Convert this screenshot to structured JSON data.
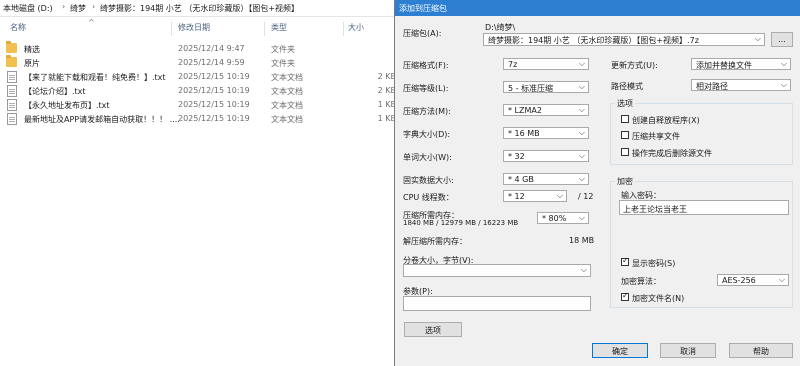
{
  "explorer": {
    "breadcrumb": [
      "本地磁盘 (D:)",
      "绮梦",
      "绮梦摄影：194期 小艺 （无水印珍藏版）【图包+视频】"
    ],
    "columns": {
      "name": "名称",
      "date": "修改日期",
      "type": "类型",
      "size": "大小"
    },
    "rows": [
      {
        "kind": "folder",
        "name": "精选",
        "date": "2025/12/14 9:47",
        "type": "文件夹",
        "size": ""
      },
      {
        "kind": "folder",
        "name": "原片",
        "date": "2025/12/14 9:59",
        "type": "文件夹",
        "size": ""
      },
      {
        "kind": "file",
        "name": "【来了就能下载和观看！纯免费！】.txt",
        "date": "2025/12/15 10:19",
        "type": "文本文档",
        "size": "2 KB"
      },
      {
        "kind": "file",
        "name": "【论坛介绍】.txt",
        "date": "2025/12/15 10:19",
        "type": "文本文档",
        "size": "2 KB"
      },
      {
        "kind": "file",
        "name": "【永久地址发布页】.txt",
        "date": "2025/12/15 10:19",
        "type": "文本文档",
        "size": "1 KB"
      },
      {
        "kind": "file",
        "name": "最新地址及APP请发邮箱自动获取！！！ ....",
        "date": "2025/12/15 10:19",
        "type": "文本文档",
        "size": "1 KB"
      }
    ]
  },
  "dialog": {
    "title": "添加到压缩包",
    "archive": {
      "label": "压缩包(A):",
      "path": "D:\\绮梦\\",
      "filename": "绮梦摄影：194期 小艺 （无水印珍藏版）【图包+视频】.7z",
      "browse": "..."
    },
    "left": [
      {
        "label": "压缩格式(F):",
        "value": "7z"
      },
      {
        "label": "压缩等级(L):",
        "value": "5 - 标准压缩"
      },
      {
        "label": "压缩方法(M):",
        "value": "* LZMA2"
      },
      {
        "label": "字典大小(D):",
        "value": "* 16 MB"
      },
      {
        "label": "单词大小(W):",
        "value": "* 32"
      },
      {
        "label": "固实数据大小:",
        "value": "* 4 GB"
      }
    ],
    "cpu": {
      "label": "CPU 线程数：",
      "value": "* 12",
      "max": "/ 12"
    },
    "memory": {
      "label": "压缩所需内存：",
      "detail": "1840 MB / 12979 MB / 16223 MB",
      "percent": "* 80%",
      "decomp_label": "解压缩所需内存：",
      "decomp_value": "18 MB"
    },
    "split": {
      "label": "分卷大小，字节(V):",
      "value": ""
    },
    "params": {
      "label": "参数(P):",
      "value": ""
    },
    "options_button": "选项",
    "update": {
      "label": "更新方式(U):",
      "value": "添加并替换文件"
    },
    "pathmode": {
      "label": "路径模式",
      "value": "相对路径"
    },
    "options_group": {
      "title": "选项",
      "items": [
        {
          "label": "创建自释放程序(X)",
          "checked": false
        },
        {
          "label": "压缩共享文件",
          "checked": false
        },
        {
          "label": "操作完成后删除源文件",
          "checked": false
        }
      ]
    },
    "encryption": {
      "title": "加密",
      "password_label": "输入密码：",
      "password": "上老王论坛当老王",
      "show_password": {
        "label": "显示密码(S)",
        "checked": true
      },
      "method_label": "加密算法：",
      "method": "AES-256",
      "encrypt_names": {
        "label": "加密文件名(N)",
        "checked": true
      }
    },
    "buttons": {
      "ok": "确定",
      "cancel": "取消",
      "help": "帮助"
    }
  }
}
